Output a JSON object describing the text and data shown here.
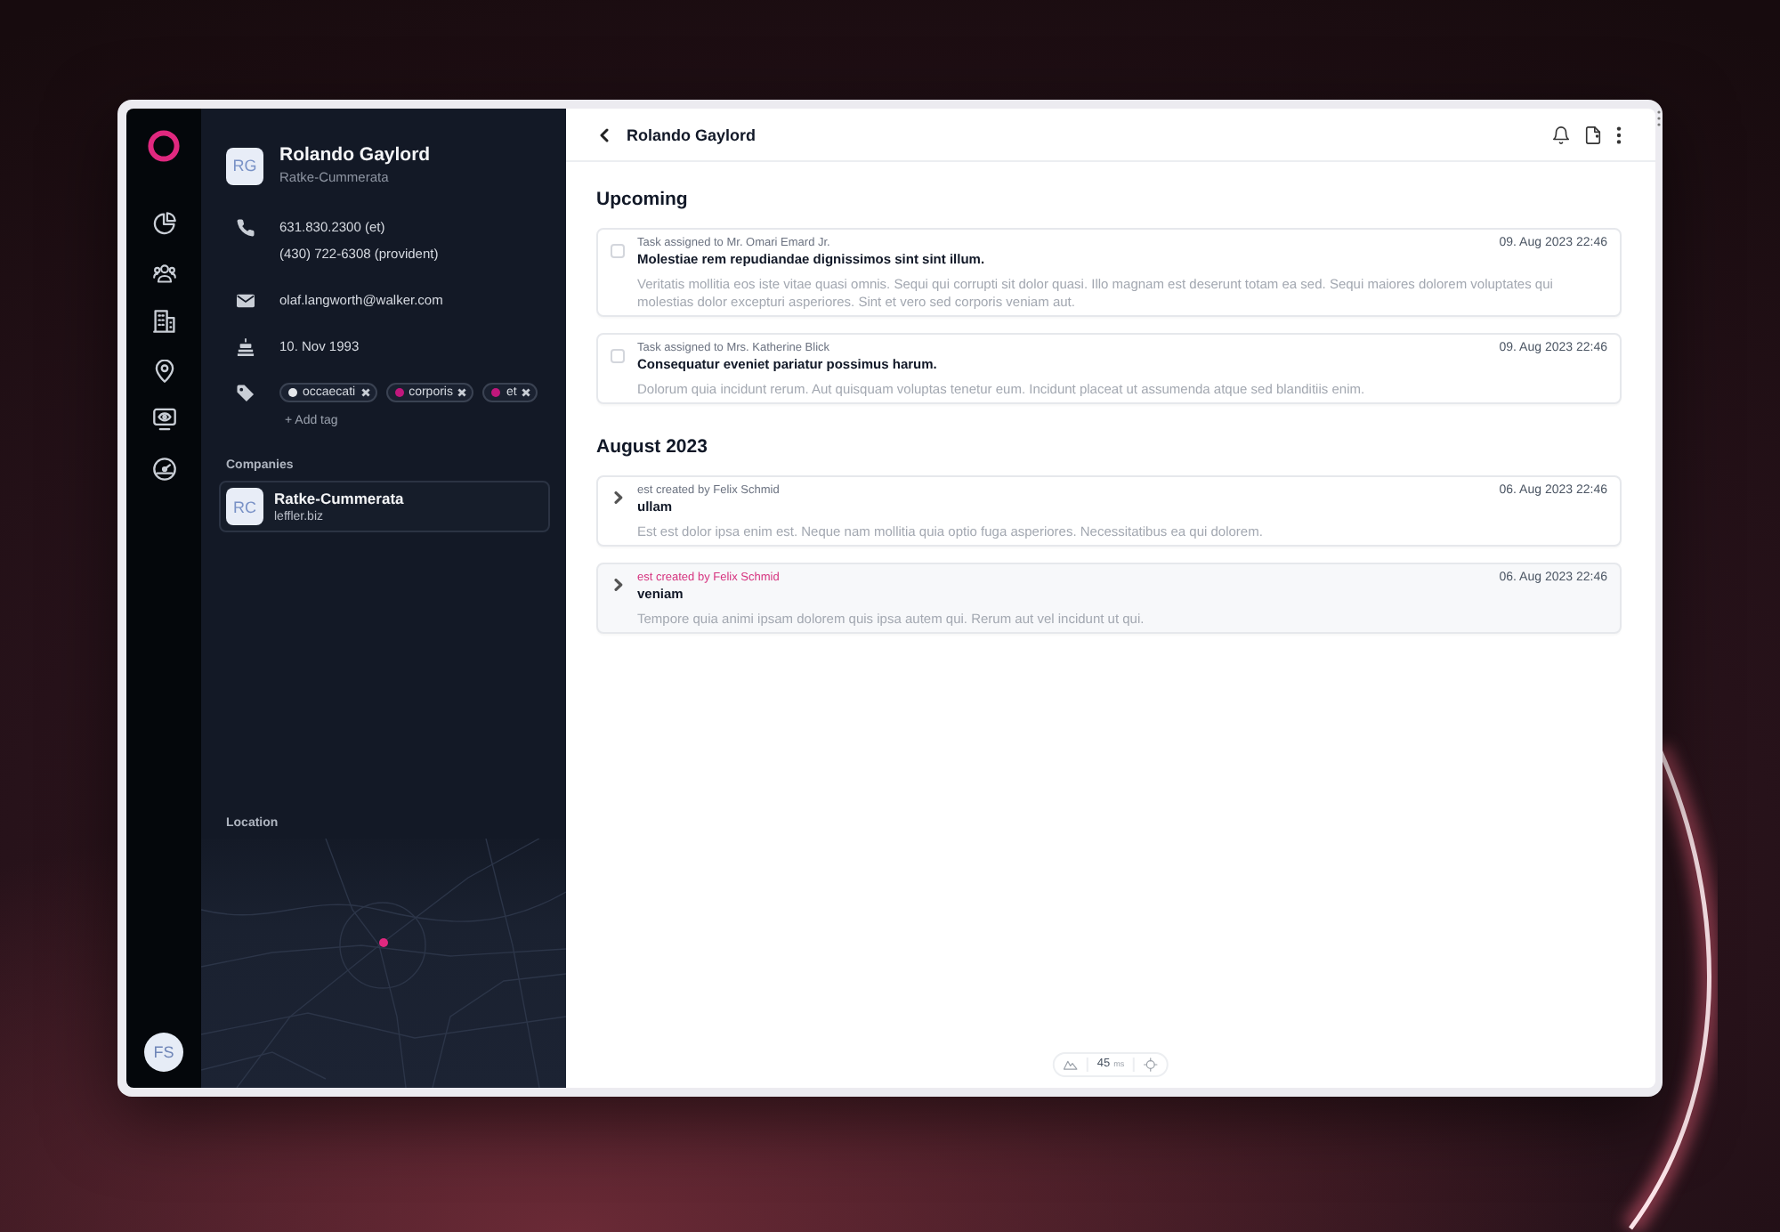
{
  "rail": {
    "user_initials": "FS"
  },
  "contact": {
    "initials": "RG",
    "name": "Rolando Gaylord",
    "company": "Ratke-Cummerata",
    "phones": [
      "631.830.2300 (et)",
      "(430) 722-6308 (provident)"
    ],
    "email": "olaf.langworth@walker.com",
    "birthday": "10. Nov 1993",
    "tags": [
      {
        "label": "occaecati",
        "color": "#e4e7eb"
      },
      {
        "label": "corporis",
        "color": "#c0177c"
      },
      {
        "label": "et",
        "color": "#c0177c"
      }
    ],
    "add_tag": "+ Add tag"
  },
  "companies": {
    "label": "Companies",
    "items": [
      {
        "initials": "RC",
        "name": "Ratke-Cummerata",
        "domain": "leffler.biz"
      }
    ]
  },
  "location": {
    "label": "Location"
  },
  "header": {
    "title": "Rolando Gaylord"
  },
  "sections": [
    {
      "title": "Upcoming",
      "items": [
        {
          "kind": "task",
          "checked": false,
          "selected": false,
          "meta": "Task assigned to Mr. Omari Emard Jr.",
          "title": "Molestiae rem repudiandae dignissimos sint sint illum.",
          "body": "Veritatis mollitia eos iste vitae quasi omnis. Sequi qui corrupti sit dolor quasi. Illo magnam est deserunt totam ea sed. Sequi maiores dolorem voluptates qui molestias dolor excepturi asperiores. Sint et vero sed corporis veniam aut.",
          "date": "09. Aug 2023 22:46"
        },
        {
          "kind": "task",
          "checked": false,
          "selected": false,
          "meta": "Task assigned to Mrs. Katherine Blick",
          "title": "Consequatur eveniet pariatur possimus harum.",
          "body": "Dolorum quia incidunt rerum. Aut quisquam voluptas tenetur eum. Incidunt placeat ut assumenda atque sed blanditiis enim.",
          "date": "09. Aug 2023 22:46"
        }
      ]
    },
    {
      "title": "August 2023",
      "items": [
        {
          "kind": "note",
          "expanded": false,
          "selected": false,
          "meta": "est created by Felix Schmid",
          "title": "ullam",
          "body": "Est est dolor ipsa enim est. Neque nam mollitia quia optio fuga asperiores. Necessitatibus ea qui dolorem.",
          "date": "06. Aug 2023 22:46"
        },
        {
          "kind": "note",
          "expanded": false,
          "selected": true,
          "meta": "est created by Felix Schmid",
          "title": "veniam",
          "body": "Tempore quia animi ipsam dolorem quis ipsa autem qui. Rerum aut vel incidunt ut qui.",
          "date": "06. Aug 2023 22:46"
        }
      ]
    }
  ],
  "latency": {
    "value": "45",
    "unit": "ms"
  }
}
